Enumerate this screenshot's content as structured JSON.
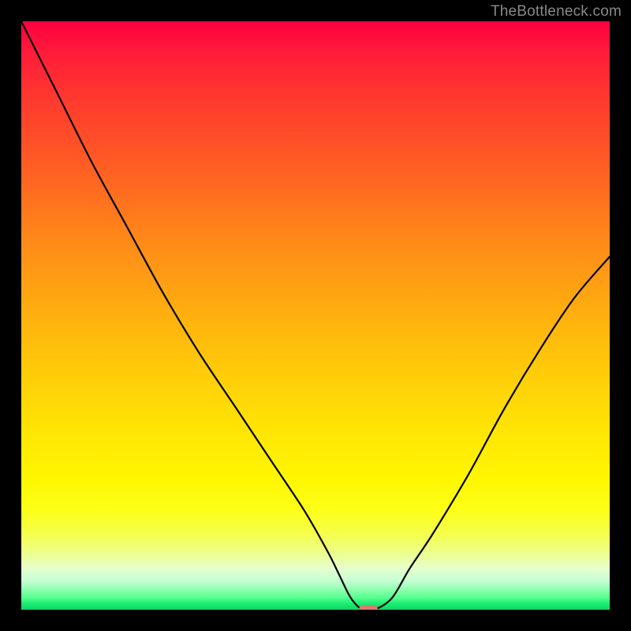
{
  "watermark": "TheBottleneck.com",
  "colors": {
    "background": "#000000",
    "gradient_top": "#ff0040",
    "gradient_bottom": "#0fd565",
    "curve_stroke": "#000000",
    "marker_fill": "#db7a6e",
    "watermark_text": "#888888"
  },
  "chart_data": {
    "type": "line",
    "title": "",
    "xlabel": "",
    "ylabel": "",
    "xlim": [
      0,
      100
    ],
    "ylim": [
      0,
      100
    ],
    "grid": false,
    "legend": false,
    "series": [
      {
        "name": "bottleneck-curve",
        "x": [
          0,
          6,
          12,
          18,
          24,
          30,
          36,
          42,
          48,
          52,
          54,
          56,
          58,
          60,
          63,
          66,
          70,
          76,
          82,
          88,
          94,
          100
        ],
        "values": [
          100,
          88,
          76,
          65,
          54,
          44,
          35,
          26,
          17,
          10,
          6,
          2,
          0,
          0,
          2,
          7,
          13,
          23,
          34,
          44,
          53,
          60
        ]
      }
    ],
    "marker": {
      "x": 59,
      "y": 0
    },
    "background_gradient": {
      "direction": "vertical",
      "stops": [
        {
          "pos": 0.0,
          "color": "#ff0040"
        },
        {
          "pos": 0.3,
          "color": "#ff701e"
        },
        {
          "pos": 0.62,
          "color": "#ffd208"
        },
        {
          "pos": 0.83,
          "color": "#fdff18"
        },
        {
          "pos": 0.95,
          "color": "#c8ffd4"
        },
        {
          "pos": 1.0,
          "color": "#0fd565"
        }
      ]
    }
  }
}
